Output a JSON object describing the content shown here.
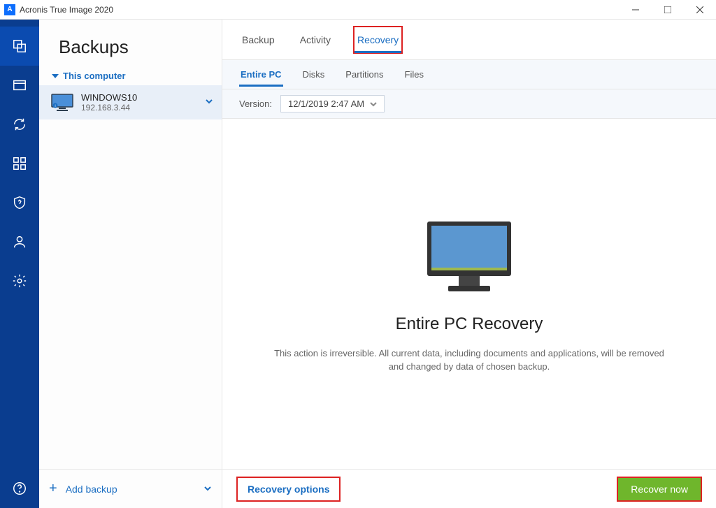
{
  "window": {
    "title": "Acronis True Image 2020"
  },
  "sidebar": {
    "heading": "Backups",
    "tree_label": "This computer",
    "backup": {
      "name": "WINDOWS10",
      "address": "192.168.3.44"
    },
    "add_label": "Add backup"
  },
  "top_tabs": {
    "backup": "Backup",
    "activity": "Activity",
    "recovery": "Recovery"
  },
  "sub_tabs": {
    "entire_pc": "Entire PC",
    "disks": "Disks",
    "partitions": "Partitions",
    "files": "Files"
  },
  "version": {
    "label": "Version:",
    "value": "12/1/2019 2:47 AM"
  },
  "content": {
    "heading": "Entire PC Recovery",
    "body": "This action is irreversible. All current data, including documents and applications, will be removed and changed by data of chosen backup."
  },
  "footer": {
    "options": "Recovery options",
    "recover": "Recover now"
  }
}
